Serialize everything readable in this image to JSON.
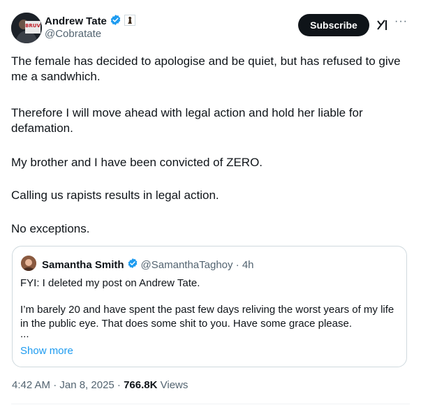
{
  "author": {
    "name": "Andrew Tate",
    "handle": "@Cobratate",
    "avatar_text": "BRUV"
  },
  "actions": {
    "subscribe_label": "Subscribe",
    "grok_icon": "grok-icon",
    "more_label": "···"
  },
  "post": {
    "paragraphs": [
      "The female has decided to apologise and be quiet, but has refused to give me a sandwhich.",
      "Therefore I will move ahead with legal action and hold her liable for defamation.",
      "My brother and I have been convicted of ZERO.",
      "Calling us rapists results in legal action.",
      "No exceptions."
    ]
  },
  "quoted": {
    "name": "Samantha Smith",
    "handle_time": "@SamanthaTaghoy · 4h",
    "line1": "FYI: I deleted my post on Andrew Tate.",
    "line2": "I’m barely 20 and have spent the past few days reliving the worst years of my life in the public eye. That does some shit to you. Have some grace please.",
    "ellipsis": "...",
    "show_more": "Show more"
  },
  "meta": {
    "time_date": "4:42 AM · Jan 8, 2025 · ",
    "views_count": "766.8K",
    "views_label": " Views"
  },
  "colors": {
    "verified": "#1d9bf0",
    "link": "#1d9bf0",
    "text": "#0f1419",
    "muted": "#536471"
  }
}
